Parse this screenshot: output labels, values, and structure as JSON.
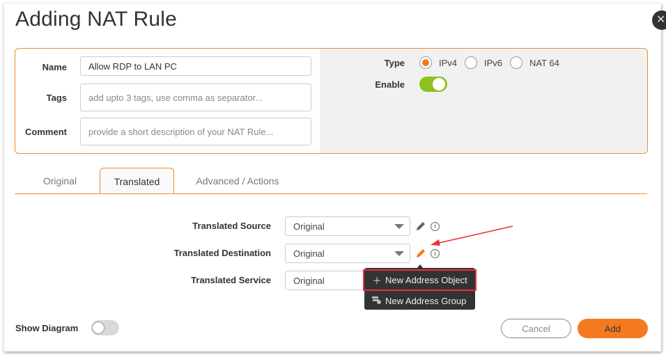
{
  "dialog": {
    "title": "Adding NAT Rule",
    "close_icon": "close-icon"
  },
  "general": {
    "name_label": "Name",
    "name_value": "Allow RDP to LAN PC",
    "tags_label": "Tags",
    "tags_placeholder": "add upto 3 tags, use comma as separator...",
    "comment_label": "Comment",
    "comment_placeholder": "provide a short description of your NAT Rule...",
    "type_label": "Type",
    "type_options": [
      {
        "label": "IPv4",
        "selected": true
      },
      {
        "label": "IPv6",
        "selected": false
      },
      {
        "label": "NAT 64",
        "selected": false
      }
    ],
    "enable_label": "Enable",
    "enable_on": true
  },
  "tabs": [
    {
      "label": "Original",
      "active": false
    },
    {
      "label": "Translated",
      "active": true
    },
    {
      "label": "Advanced / Actions",
      "active": false
    }
  ],
  "translated": {
    "fields": [
      {
        "label": "Translated Source",
        "value": "Original"
      },
      {
        "label": "Translated Destination",
        "value": "Original"
      },
      {
        "label": "Translated Service",
        "value": "Original"
      }
    ]
  },
  "context_menu": {
    "items": [
      {
        "label": "New Address Object",
        "icon": "plus-icon",
        "highlighted": true
      },
      {
        "label": "New Address Group",
        "icon": "address-group-icon",
        "highlighted": false
      }
    ]
  },
  "footer": {
    "show_diagram_label": "Show Diagram",
    "show_diagram_on": false,
    "cancel_label": "Cancel",
    "add_label": "Add"
  },
  "colors": {
    "accent": "#f07a1f",
    "toggle_on": "#8dc21f",
    "highlight_box": "#e8303a",
    "annotation_arrow": "#e8303a"
  }
}
